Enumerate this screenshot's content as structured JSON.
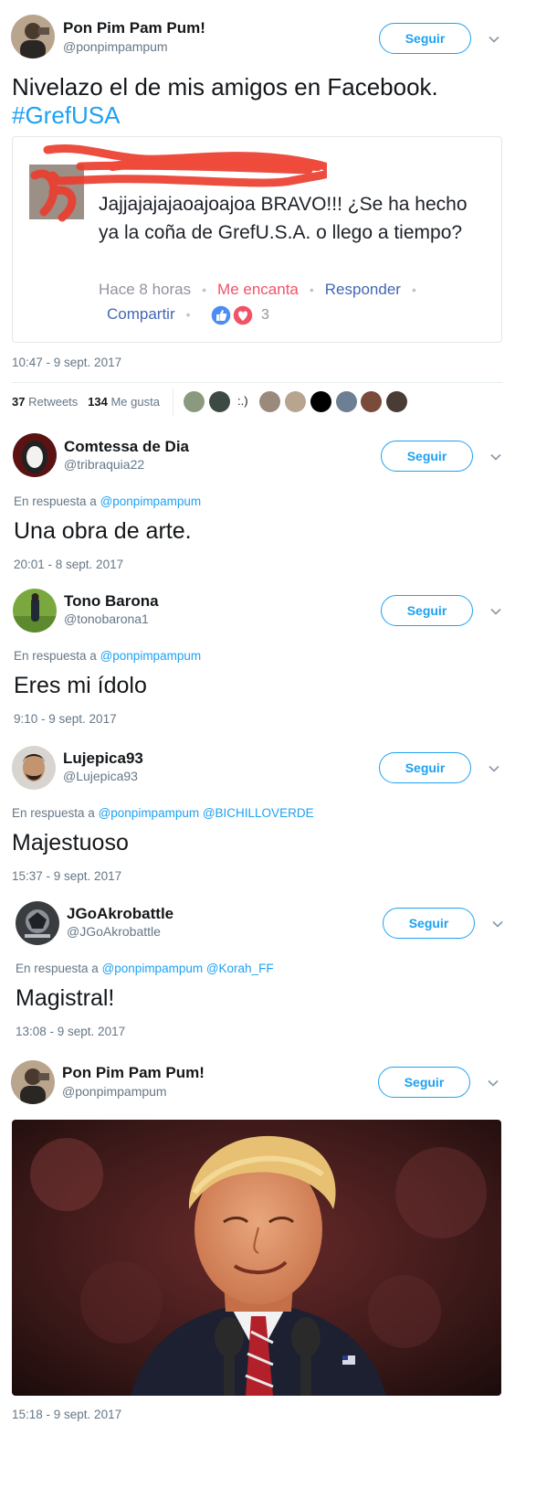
{
  "main_tweet": {
    "display_name": "Pon Pim Pam Pum!",
    "handle": "@ponpimpampum",
    "follow_label": "Seguir",
    "text": "Nivelazo el de mis amigos en Facebook.",
    "hashtag": "#GrefUSA",
    "timestamp": "10:47 - 9 sept. 2017",
    "fb_comment": {
      "text": "Jajjajajajaoajoajoa BRAVO!!! ¿Se ha hecho ya la coña de GrefU.S.A. o llego a tiempo?",
      "time": "Hace 8 horas",
      "love_label": "Me encanta",
      "reply_label": "Responder",
      "share_label": "Compartir",
      "reaction_count": "3"
    },
    "stats": {
      "retweets_count": "37",
      "retweets_label": "Retweets",
      "likes_count": "134",
      "likes_label": "Me gusta",
      "smile_text": ":.)"
    }
  },
  "replies": [
    {
      "display_name": "Comtessa de Dia",
      "handle": "@tribraquia22",
      "follow_label": "Seguir",
      "reply_prefix": "En respuesta a",
      "mentions": "@ponpimpampum",
      "text": "Una obra de arte.",
      "timestamp": "20:01 - 8 sept. 2017"
    },
    {
      "display_name": "Tono Barona",
      "handle": "@tonobarona1",
      "follow_label": "Seguir",
      "reply_prefix": "En respuesta a",
      "mentions": "@ponpimpampum",
      "text": "Eres mi ídolo",
      "timestamp": "9:10 - 9 sept. 2017"
    },
    {
      "display_name": "Lujepica93",
      "handle": "@Lujepica93",
      "follow_label": "Seguir",
      "reply_prefix": "En respuesta a",
      "mentions": "@ponpimpampum @BICHILLOVERDE",
      "text": "Majestuoso",
      "timestamp": "15:37 - 9 sept. 2017"
    },
    {
      "display_name": "JGoAkrobattle",
      "handle": "@JGoAkrobattle",
      "follow_label": "Seguir",
      "reply_prefix": "En respuesta a",
      "mentions": "@ponpimpampum @Korah_FF",
      "text": "Magistral!",
      "timestamp": "13:08 - 9 sept. 2017"
    }
  ],
  "last_tweet": {
    "display_name": "Pon Pim Pam Pum!",
    "handle": "@ponpimpampum",
    "follow_label": "Seguir",
    "timestamp": "15:18 - 9 sept. 2017"
  },
  "colors": {
    "twitter_blue": "#1da1f2",
    "facebook_blue": "#4267b2",
    "love_red": "#f25268",
    "secondary_text": "#657786"
  },
  "icons": [
    "chevron-down-icon",
    "like-reaction-icon",
    "love-reaction-icon",
    "redacted-scribble"
  ]
}
